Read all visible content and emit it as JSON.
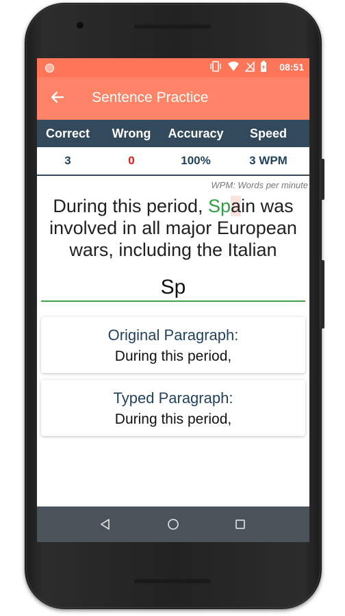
{
  "status_bar": {
    "time": "08:51",
    "icons": [
      "vibrate-icon",
      "wifi-icon",
      "no-signal-icon",
      "battery-icon"
    ]
  },
  "app_bar": {
    "title": "Sentence Practice",
    "back_icon": "back-arrow-icon"
  },
  "stats": {
    "headers": [
      "Correct",
      "Wrong",
      "Accuracy",
      "Speed"
    ],
    "values": [
      "3",
      "0",
      "100%",
      "3 WPM"
    ]
  },
  "wpm_note": "WPM: Words per minute",
  "sentence": {
    "before": "During this period, ",
    "correct_part": "Sp",
    "current_char": "a",
    "after": "in was involved in all major European wars, including the Italian"
  },
  "typed_input": {
    "value": "Sp"
  },
  "original_card": {
    "title": "Original Paragraph:",
    "body": "During this period,"
  },
  "typed_card": {
    "title": "Typed Paragraph:",
    "body": "During this period,"
  },
  "nav_bar": {
    "icons": [
      "back-triangle-icon",
      "home-circle-icon",
      "recents-square-icon"
    ]
  },
  "colors": {
    "status_bar": "#ff7558",
    "app_bar": "#ff8366",
    "stats_header": "#33495c",
    "wrong_value": "#e31b10",
    "typed_highlight": "#2ea043",
    "input_underline": "#3da447",
    "nav_bar": "#4a535a"
  }
}
